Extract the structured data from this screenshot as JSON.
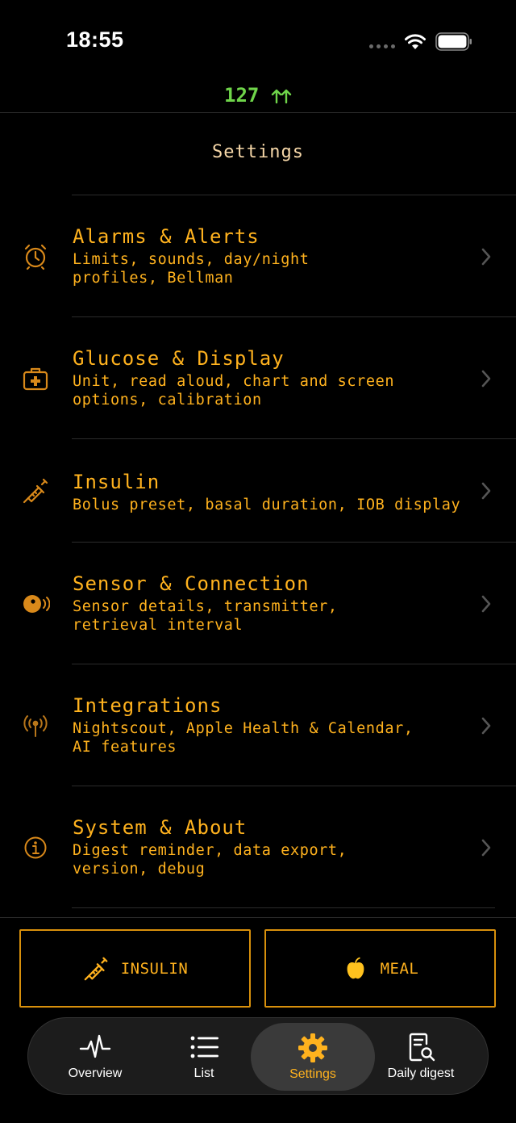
{
  "status_bar": {
    "time": "18:55"
  },
  "glucose": {
    "value": "127",
    "trend": "rising-fast",
    "color": "#6fd54a"
  },
  "page": {
    "title": "Settings"
  },
  "accent_color": "#ffb21e",
  "settings": [
    {
      "icon": "alarm-clock-icon",
      "title": "Alarms & Alerts",
      "subtitle": "Limits, sounds, day/night\nprofiles, Bellman"
    },
    {
      "icon": "medical-kit-icon",
      "title": "Glucose & Display",
      "subtitle": "Unit, read aloud, chart and screen\noptions, calibration"
    },
    {
      "icon": "syringe-icon",
      "title": "Insulin",
      "subtitle": "Bolus preset, basal duration, IOB display"
    },
    {
      "icon": "sensor-signal-icon",
      "title": "Sensor & Connection",
      "subtitle": "Sensor details, transmitter,\nretrieval interval"
    },
    {
      "icon": "antenna-icon",
      "title": "Integrations",
      "subtitle": "Nightscout, Apple Health & Calendar,\nAI features"
    },
    {
      "icon": "info-icon",
      "title": "System & About",
      "subtitle": "Digest reminder, data export,\nversion, debug"
    }
  ],
  "actions": {
    "insulin_label": "INSULIN",
    "meal_label": "MEAL"
  },
  "tabs": [
    {
      "label": "Overview",
      "icon": "heartbeat-icon",
      "selected": false
    },
    {
      "label": "List",
      "icon": "list-icon",
      "selected": false
    },
    {
      "label": "Settings",
      "icon": "gear-icon",
      "selected": true
    },
    {
      "label": "Daily digest",
      "icon": "document-search-icon",
      "selected": false
    }
  ]
}
